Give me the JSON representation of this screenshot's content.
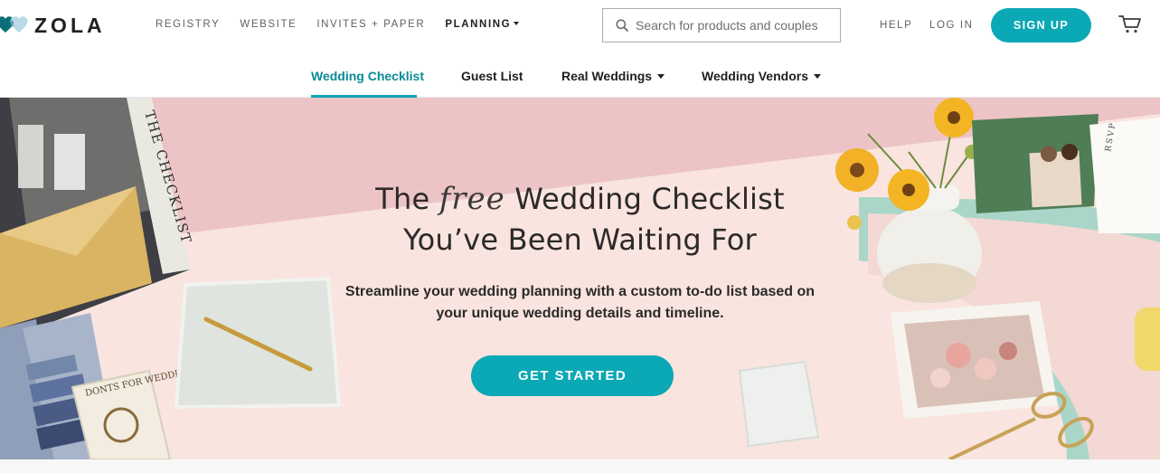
{
  "brand": {
    "name": "ZOLA"
  },
  "nav": {
    "items": [
      {
        "label": "REGISTRY"
      },
      {
        "label": "WEBSITE"
      },
      {
        "label": "INVITES + PAPER"
      },
      {
        "label": "PLANNING"
      }
    ]
  },
  "search": {
    "placeholder": "Search for products and couples"
  },
  "header": {
    "help": "HELP",
    "login": "LOG IN",
    "signup": "SIGN UP"
  },
  "subnav": {
    "items": [
      {
        "label": "Wedding Checklist"
      },
      {
        "label": "Guest List"
      },
      {
        "label": "Real Weddings"
      },
      {
        "label": "Wedding Vendors"
      }
    ]
  },
  "hero": {
    "title_pre": "The",
    "title_script": "free",
    "title_post": "Wedding Checklist",
    "title_line2": "You’ve Been Waiting For",
    "subtitle_line1": "Streamline your wedding planning with a custom to-do list based on",
    "subtitle_line2": "your unique wedding details and timeline.",
    "cta": "GET STARTED"
  },
  "decor": {
    "book_title": "THE CHECKLIST",
    "small_book": "DONTS FOR WEDDINGS",
    "rsvp": "RSVP"
  },
  "colors": {
    "accent": "#0ba8b5",
    "hero_bg": "#f6d9d6"
  }
}
